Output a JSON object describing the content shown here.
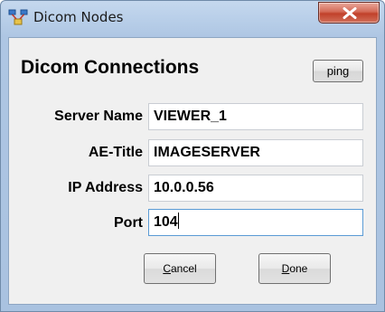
{
  "window": {
    "title": "Dicom Nodes"
  },
  "dialog": {
    "heading": "Dicom Connections",
    "ping_label": "ping",
    "fields": [
      {
        "label": "Server Name",
        "value": "VIEWER_1"
      },
      {
        "label": "AE-Title",
        "value": "IMAGESERVER"
      },
      {
        "label": "IP Address",
        "value": "10.0.0.56"
      },
      {
        "label": "Port",
        "value": "104"
      }
    ],
    "cancel": {
      "mnemonic": "C",
      "rest": "ancel"
    },
    "done": {
      "mnemonic": "D",
      "rest": "one"
    }
  },
  "icons": {
    "app": "network-nodes-icon",
    "close": "close-icon"
  },
  "colors": {
    "close_button": "#c1402a",
    "client_background": "#f0f0f0",
    "focus_border": "#5a9bd5"
  }
}
